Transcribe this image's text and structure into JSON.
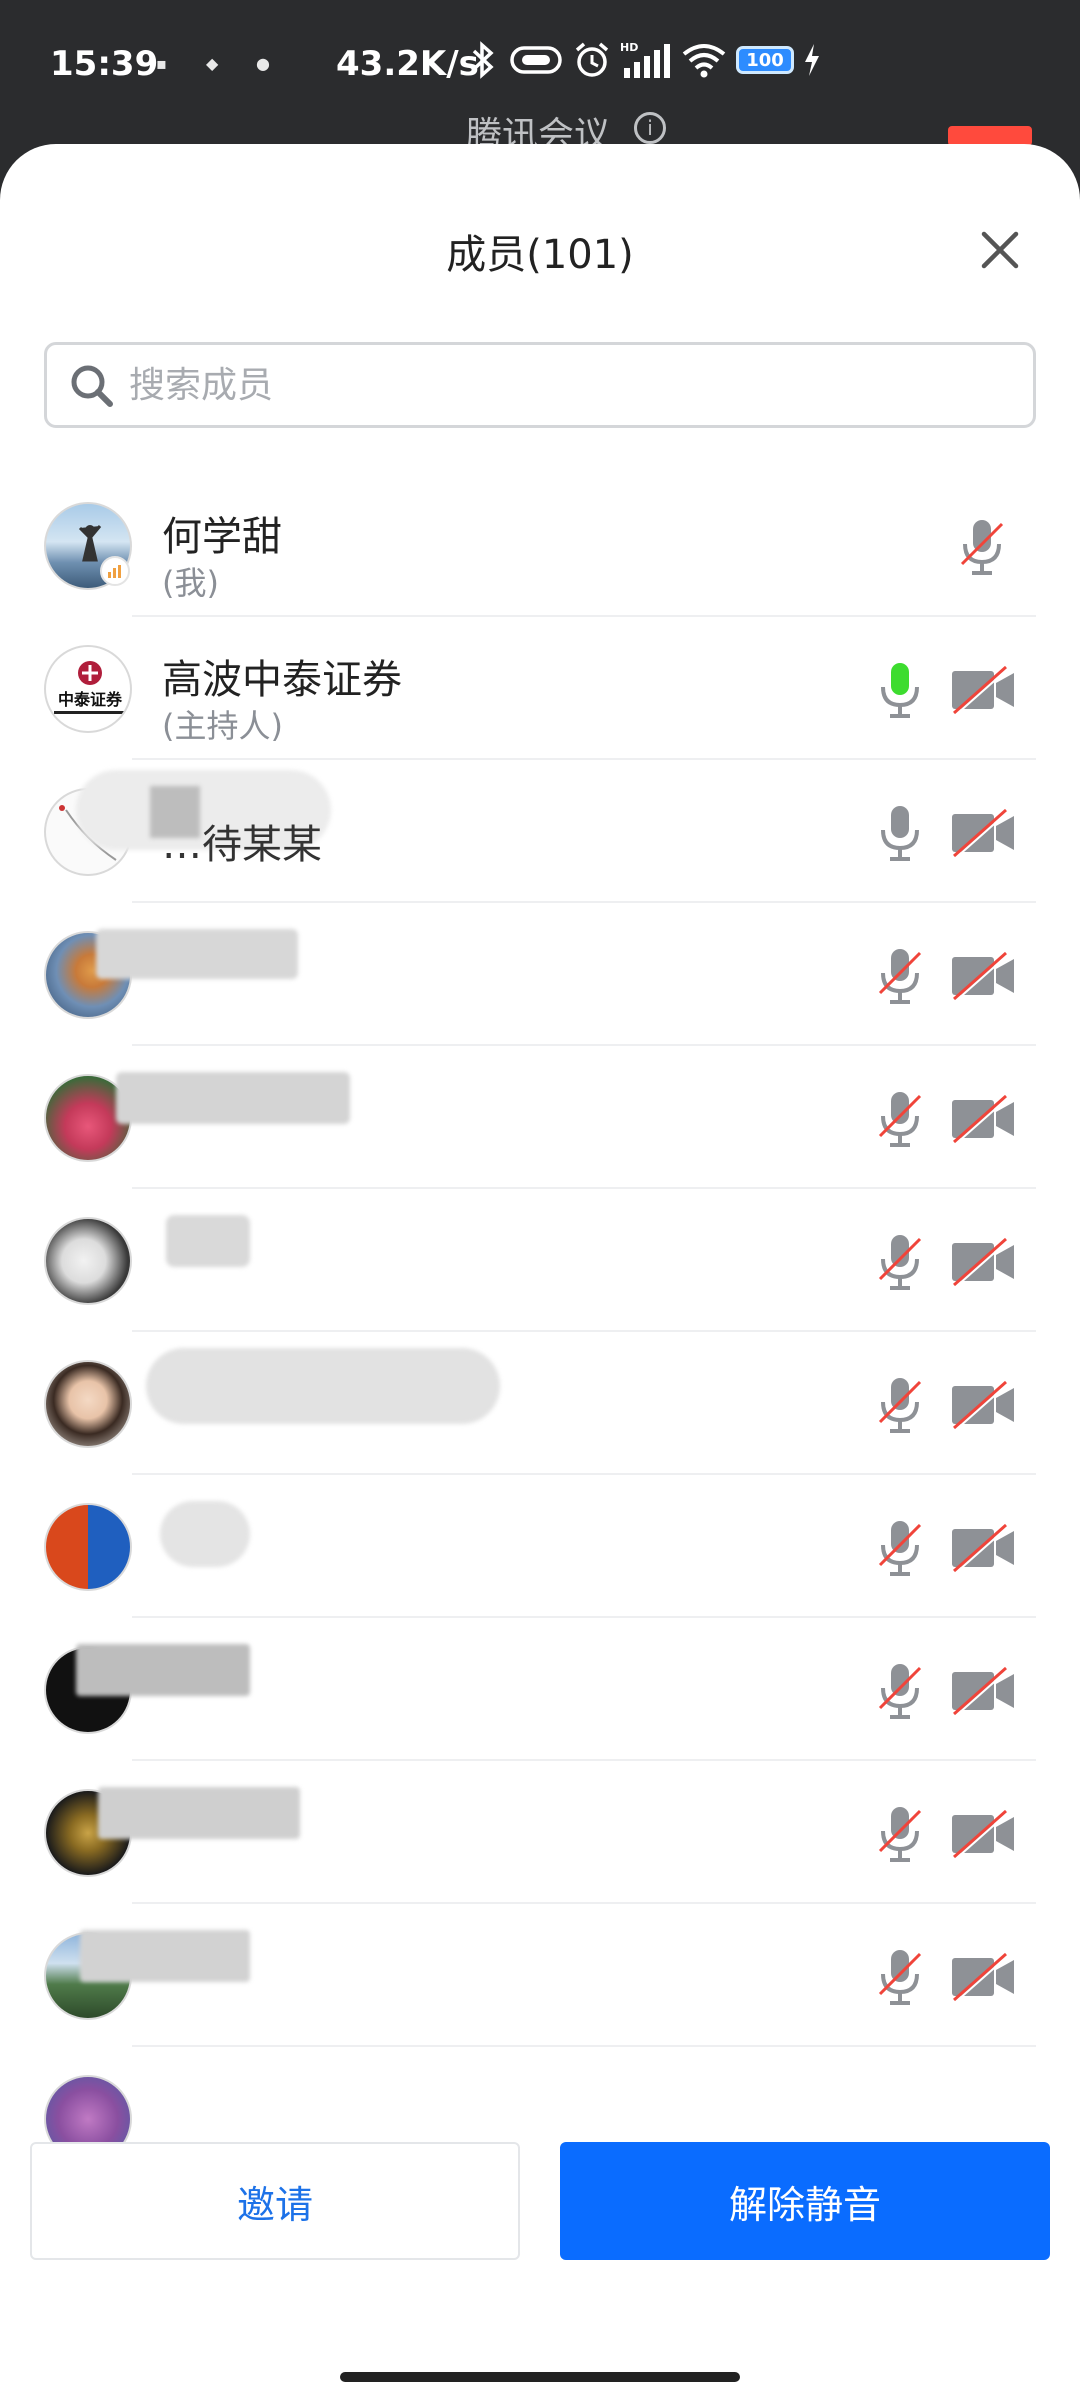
{
  "status_bar": {
    "time": "15:39",
    "net_speed": "43.2K/s",
    "battery": "100",
    "icons": [
      "app-notification-icon",
      "app-notification-icon",
      "app-notification-icon",
      "bluetooth-icon",
      "vibrate-icon",
      "alarm-icon",
      "hd-signal-icon",
      "wifi-icon",
      "battery-icon",
      "charging-icon"
    ]
  },
  "background": {
    "app_title": "腾讯会议",
    "info_icon": "info-icon"
  },
  "sheet": {
    "title": "成员(101)",
    "close_icon": "close-icon"
  },
  "search": {
    "placeholder": "搜索成员",
    "value": "",
    "icon": "search-icon"
  },
  "members": [
    {
      "name": "何学甜",
      "subtitle": "(我)",
      "mic": "muted",
      "camera": null
    },
    {
      "name": "高波中泰证券",
      "subtitle": "(主持人)",
      "mic": "speaking",
      "camera": "off",
      "avatar_text": "中泰证券"
    },
    {
      "name": "…待某某",
      "subtitle": "",
      "mic": "on",
      "camera": "off"
    },
    {
      "name": "",
      "subtitle": "",
      "mic": "muted",
      "camera": "off"
    },
    {
      "name": "",
      "subtitle": "",
      "mic": "muted",
      "camera": "off"
    },
    {
      "name": "",
      "subtitle": "",
      "mic": "muted",
      "camera": "off"
    },
    {
      "name": "",
      "subtitle": "",
      "mic": "muted",
      "camera": "off"
    },
    {
      "name": "",
      "subtitle": "",
      "mic": "muted",
      "camera": "off"
    },
    {
      "name": "",
      "subtitle": "",
      "mic": "muted",
      "camera": "off"
    },
    {
      "name": "",
      "subtitle": "",
      "mic": "muted",
      "camera": "off"
    },
    {
      "name": "",
      "subtitle": "",
      "mic": "muted",
      "camera": "off"
    }
  ],
  "footer": {
    "invite_label": "邀请",
    "unmute_label": "解除静音"
  },
  "colors": {
    "accent": "#0a6cff",
    "invite_text": "#1d72e8",
    "speaking_green": "#3ddc2f",
    "muted_red": "#f0443a",
    "icon_gray": "#8e9196"
  }
}
